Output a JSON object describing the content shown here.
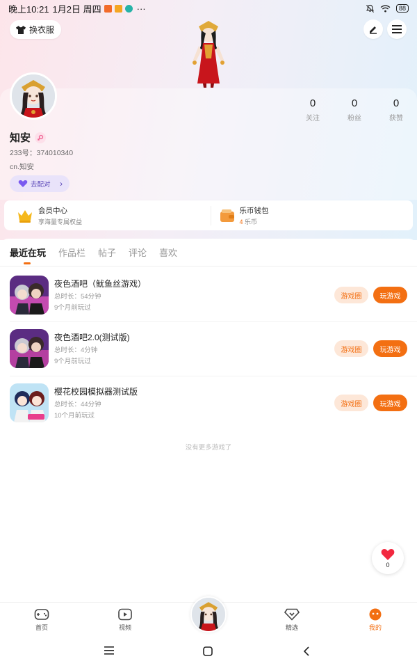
{
  "status_bar": {
    "time": "晚上10:21",
    "date": "1月2日 周四",
    "more": "···",
    "battery": "88",
    "badge_colors": [
      "#f26b2a",
      "#f5a623",
      "#27b3a7"
    ]
  },
  "header": {
    "outfit_label": "换衣服",
    "edit_icon": "pencil-icon",
    "menu_icon": "hamburger-icon"
  },
  "stats": [
    {
      "value": "0",
      "label": "关注"
    },
    {
      "value": "0",
      "label": "粉丝"
    },
    {
      "value": "0",
      "label": "获赞"
    }
  ],
  "profile": {
    "name": "知安",
    "id_text": "233号：374010340",
    "bio": "cn.知安",
    "pair_label": "去配对"
  },
  "services": {
    "member": {
      "title": "会员中心",
      "subtitle": "享海量专属权益"
    },
    "wallet": {
      "title": "乐币钱包",
      "amount": "4",
      "unit": "乐币"
    }
  },
  "tabs": [
    "最近在玩",
    "作品栏",
    "帖子",
    "评论",
    "喜欢"
  ],
  "games": [
    {
      "name": "夜色酒吧（鱿鱼丝游戏）",
      "duration": "总时长：54分钟",
      "last_played": "9个月前玩过",
      "circle_label": "游戏圈",
      "play_label": "玩游戏"
    },
    {
      "name": "夜色酒吧2.0(测试版)",
      "duration": "总时长：4分钟",
      "last_played": "9个月前玩过",
      "circle_label": "游戏圈",
      "play_label": "玩游戏"
    },
    {
      "name": "樱花校园模拟器测试版",
      "duration": "总时长：44分钟",
      "last_played": "10个月前玩过",
      "circle_label": "游戏圈",
      "play_label": "玩游戏"
    }
  ],
  "list_footer": "没有更多游戏了",
  "like_count": "0",
  "bottom_nav": [
    {
      "label": "首页",
      "icon": "gamepad-icon"
    },
    {
      "label": "视频",
      "icon": "video-icon"
    },
    {
      "label": "精选",
      "icon": "heart-diamond-icon"
    },
    {
      "label": "我的",
      "icon": "face-icon"
    }
  ],
  "colors": {
    "accent": "#f36f12",
    "pair_bg": "#e9e3fa",
    "pair_text": "#5a47b8"
  }
}
